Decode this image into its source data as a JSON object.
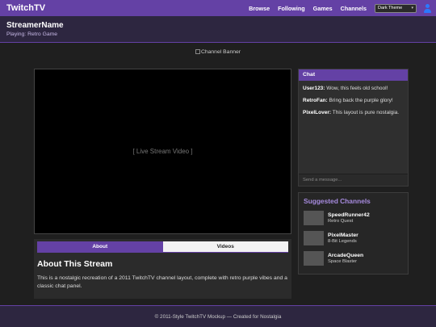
{
  "colors": {
    "accent": "#6441a5",
    "accent_light": "#a78bdf",
    "background": "#1f1f1f"
  },
  "topbar": {
    "logo": "TwitchTV",
    "nav": [
      "Browse",
      "Following",
      "Games",
      "Channels"
    ],
    "theme_select": "Dark Theme",
    "user_icon": "user-icon"
  },
  "streamer": {
    "name": "StreamerName",
    "game": "Playing: Retro Game"
  },
  "banner": {
    "alt": "Channel Banner",
    "icon": "broken-image-icon"
  },
  "video": {
    "label": "[ Live Stream Video ]"
  },
  "tabs": {
    "items": [
      "About",
      "Videos"
    ],
    "active": "About"
  },
  "about": {
    "title": "About This Stream",
    "text": "This is a nostalgic recreation of a 2011 TwitchTV channel layout, complete with retro purple vibes and a classic chat panel."
  },
  "chat": {
    "title": "Chat",
    "messages": [
      {
        "user": "User123:",
        "text": " Wow, this feels old school!"
      },
      {
        "user": "RetroFan:",
        "text": " Bring back the purple glory!"
      },
      {
        "user": "PixelLover:",
        "text": " This layout is pure nostalgia."
      }
    ],
    "input_placeholder": "Send a message..."
  },
  "suggested": {
    "title": "Suggested Channels",
    "channels": [
      {
        "name": "SpeedRunner42",
        "game": "Retro Quest"
      },
      {
        "name": "PixelMaster",
        "game": "8-Bit Legends"
      },
      {
        "name": "ArcadeQueen",
        "game": "Space Blaster"
      }
    ]
  },
  "footer": {
    "text": "© 2011-Style TwitchTV Mockup — Created for Nostalgia"
  }
}
